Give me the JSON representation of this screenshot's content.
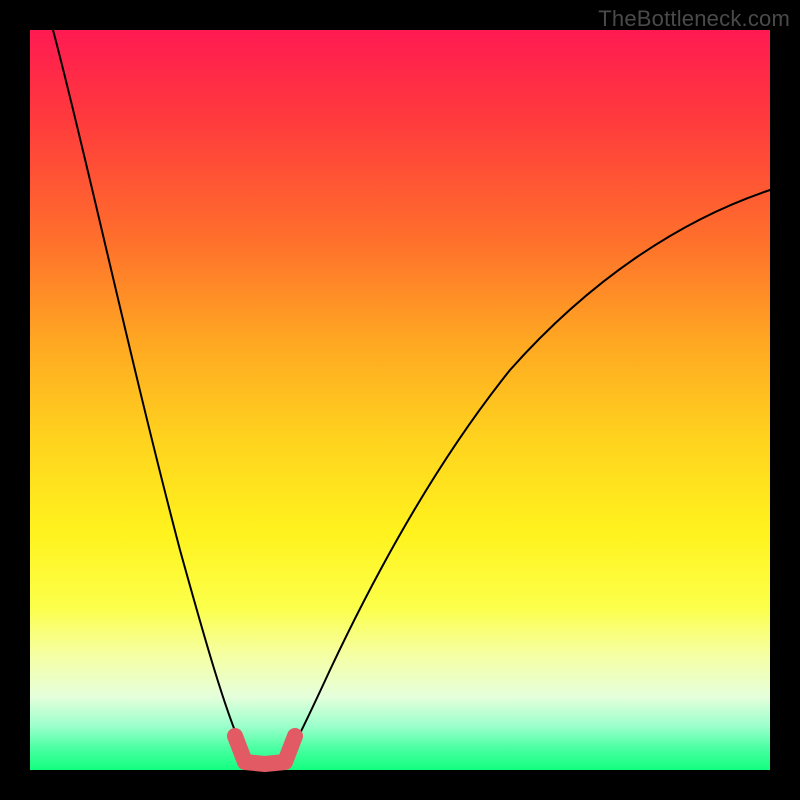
{
  "watermark": "TheBottleneck.com",
  "chart_data": {
    "type": "line",
    "title": "",
    "xlabel": "",
    "ylabel": "",
    "xlim": [
      0,
      100
    ],
    "ylim": [
      0,
      100
    ],
    "grid": false,
    "legend": false,
    "series": [
      {
        "name": "left-curve",
        "x": [
          3,
          6,
          10,
          14,
          18,
          22,
          25,
          27,
          28.5,
          29.5
        ],
        "y": [
          100,
          82,
          60,
          42,
          28,
          16,
          8,
          3,
          1,
          0
        ]
      },
      {
        "name": "right-curve",
        "x": [
          33,
          34,
          36,
          40,
          46,
          54,
          64,
          76,
          88,
          100
        ],
        "y": [
          0,
          1,
          4,
          12,
          24,
          38,
          52,
          64,
          73,
          79
        ]
      },
      {
        "name": "optimal-zone-marker",
        "x": [
          28,
          29,
          30,
          31,
          32,
          33,
          34
        ],
        "y": [
          4,
          1,
          0,
          0,
          0,
          1,
          4
        ],
        "color": "#e25a63"
      }
    ],
    "background_gradient": {
      "top": "#ff1a52",
      "upper_mid": "#ffa722",
      "mid": "#fff31e",
      "lower": "#13ff7f"
    }
  }
}
